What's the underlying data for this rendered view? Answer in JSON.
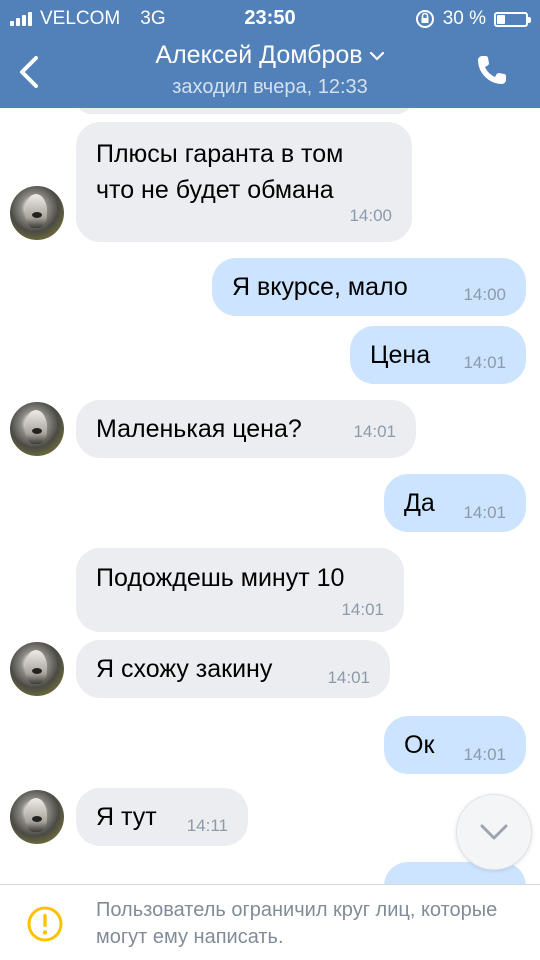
{
  "status_bar": {
    "carrier": "VELCOM",
    "network": "3G",
    "time": "23:50",
    "battery_percent": "30 %",
    "battery_level": 0.3
  },
  "header": {
    "contact_name": "Алексей Домбров",
    "last_seen": "заходил вчера, 12:33",
    "accent_color": "#5181b8"
  },
  "messages": [
    {
      "direction": "in",
      "text": "Плюсы гаранта в том\nчто не будет обмана",
      "time": "14:00",
      "avatar": true
    },
    {
      "direction": "out",
      "text": "Я вкурсе, мало",
      "time": "14:00"
    },
    {
      "direction": "out",
      "text": "Цена",
      "time": "14:01"
    },
    {
      "direction": "in",
      "text": "Маленькая цена?",
      "time": "14:01",
      "avatar": true
    },
    {
      "direction": "out",
      "text": "Да",
      "time": "14:01"
    },
    {
      "direction": "in",
      "text": "Подождешь минут 10",
      "time": "14:01",
      "avatar": false
    },
    {
      "direction": "in",
      "text": "Я схожу закину",
      "time": "14:01",
      "avatar": true
    },
    {
      "direction": "out",
      "text": "Ок",
      "time": "14:01"
    },
    {
      "direction": "in",
      "text": "Я тут",
      "time": "14:11",
      "avatar": true
    }
  ],
  "footer": {
    "notice": "Пользователь ограничил круг лиц, которые могут ему написать."
  },
  "icons": {
    "back": "chevron-left-icon",
    "phone": "phone-icon",
    "scroll_down": "chevron-down-icon",
    "warning": "warning-icon"
  }
}
